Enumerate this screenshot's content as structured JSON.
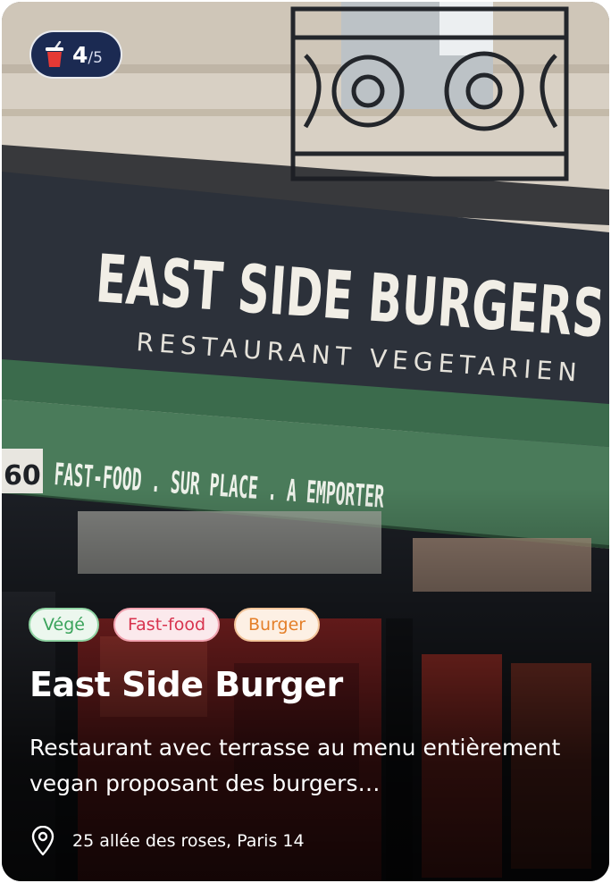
{
  "restaurant": {
    "name": "East Side Burger",
    "description": "Restaurant avec terrasse au menu entièrement vegan proposant des burgers…",
    "address": "25 allée des roses, Paris 14"
  },
  "rating": {
    "value": "4",
    "separator": "/",
    "max": "5",
    "icon": "drink-cup-icon"
  },
  "tags": [
    {
      "label": "Végé",
      "color": "#3aa35b"
    },
    {
      "label": "Fast-food",
      "color": "#d8334e"
    },
    {
      "label": "Burger",
      "color": "#e47f29"
    }
  ],
  "photo": {
    "storefront_sign": "EAST SIDE BURGERS",
    "storefront_subtitle": "RESTAURANT VEGETARIEN",
    "awning_text": "FAST-FOOD . SUR PLACE . A EMPORTER",
    "street_number": "60"
  },
  "icons": {
    "location": "location-pin-icon"
  }
}
